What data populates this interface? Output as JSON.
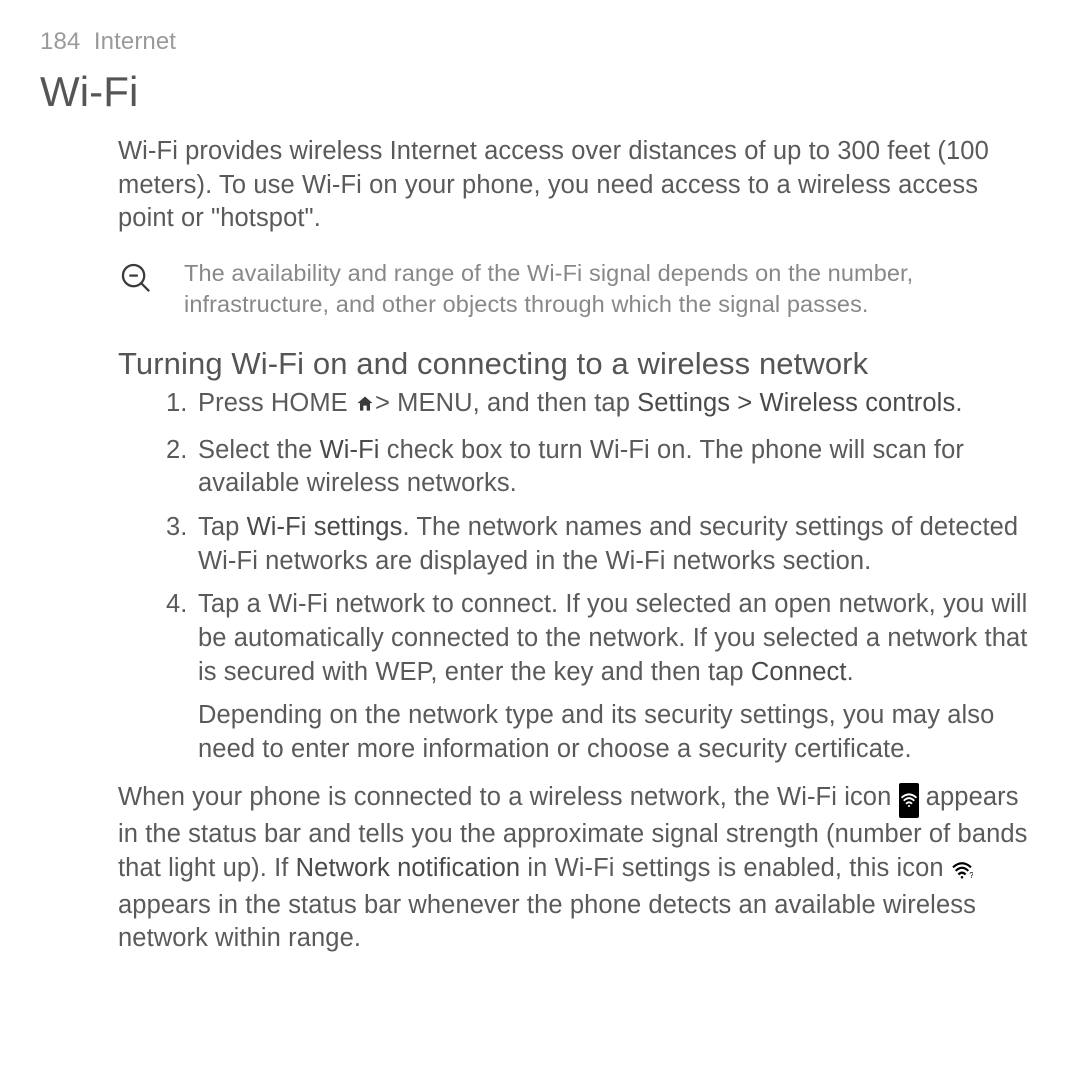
{
  "header": {
    "page_num": "184",
    "section": "Internet"
  },
  "title": "Wi-Fi",
  "intro": "Wi-Fi provides wireless Internet access over distances of up to 300 feet (100 meters). To use Wi-Fi on your phone, you need access to a wireless access point or \"hotspot\".",
  "note": "The availability and range of the Wi-Fi signal depends on the number, infrastructure, and other objects through which the signal passes.",
  "subhead": "Turning Wi-Fi on and connecting to a wireless network",
  "steps": {
    "s1_a": "Press HOME ",
    "s1_b": "> MENU, and then tap ",
    "s1_bold": "Settings > Wireless controls",
    "s1_c": ".",
    "s2_a": "Select the ",
    "s2_bold": "Wi-Fi",
    "s2_b": " check box to turn Wi-Fi on. The phone will scan for available wireless networks.",
    "s3_a": "Tap ",
    "s3_bold": "Wi-Fi settings",
    "s3_b": ". The network names and security settings of detected Wi-Fi networks are displayed in the Wi-Fi networks section.",
    "s4_a": "Tap a Wi-Fi network to connect. If you selected an open network, you will be automatically connected to the network. If you selected a network that is secured with WEP, enter the key and then tap ",
    "s4_bold": "Connect",
    "s4_b": ".",
    "s4_sub": "Depending on the network type and its security settings, you may also need to enter more information or choose a security certificate."
  },
  "after": {
    "a": "When your phone is connected to a wireless network, the Wi-Fi icon ",
    "b": " appears in the status bar and tells you the approximate signal strength (number of bands that light up). If ",
    "bold1": "Network notification",
    "c": " in Wi-Fi settings is enabled, this icon ",
    "d": " appears in the status bar whenever the phone detects an available wireless network within range."
  }
}
